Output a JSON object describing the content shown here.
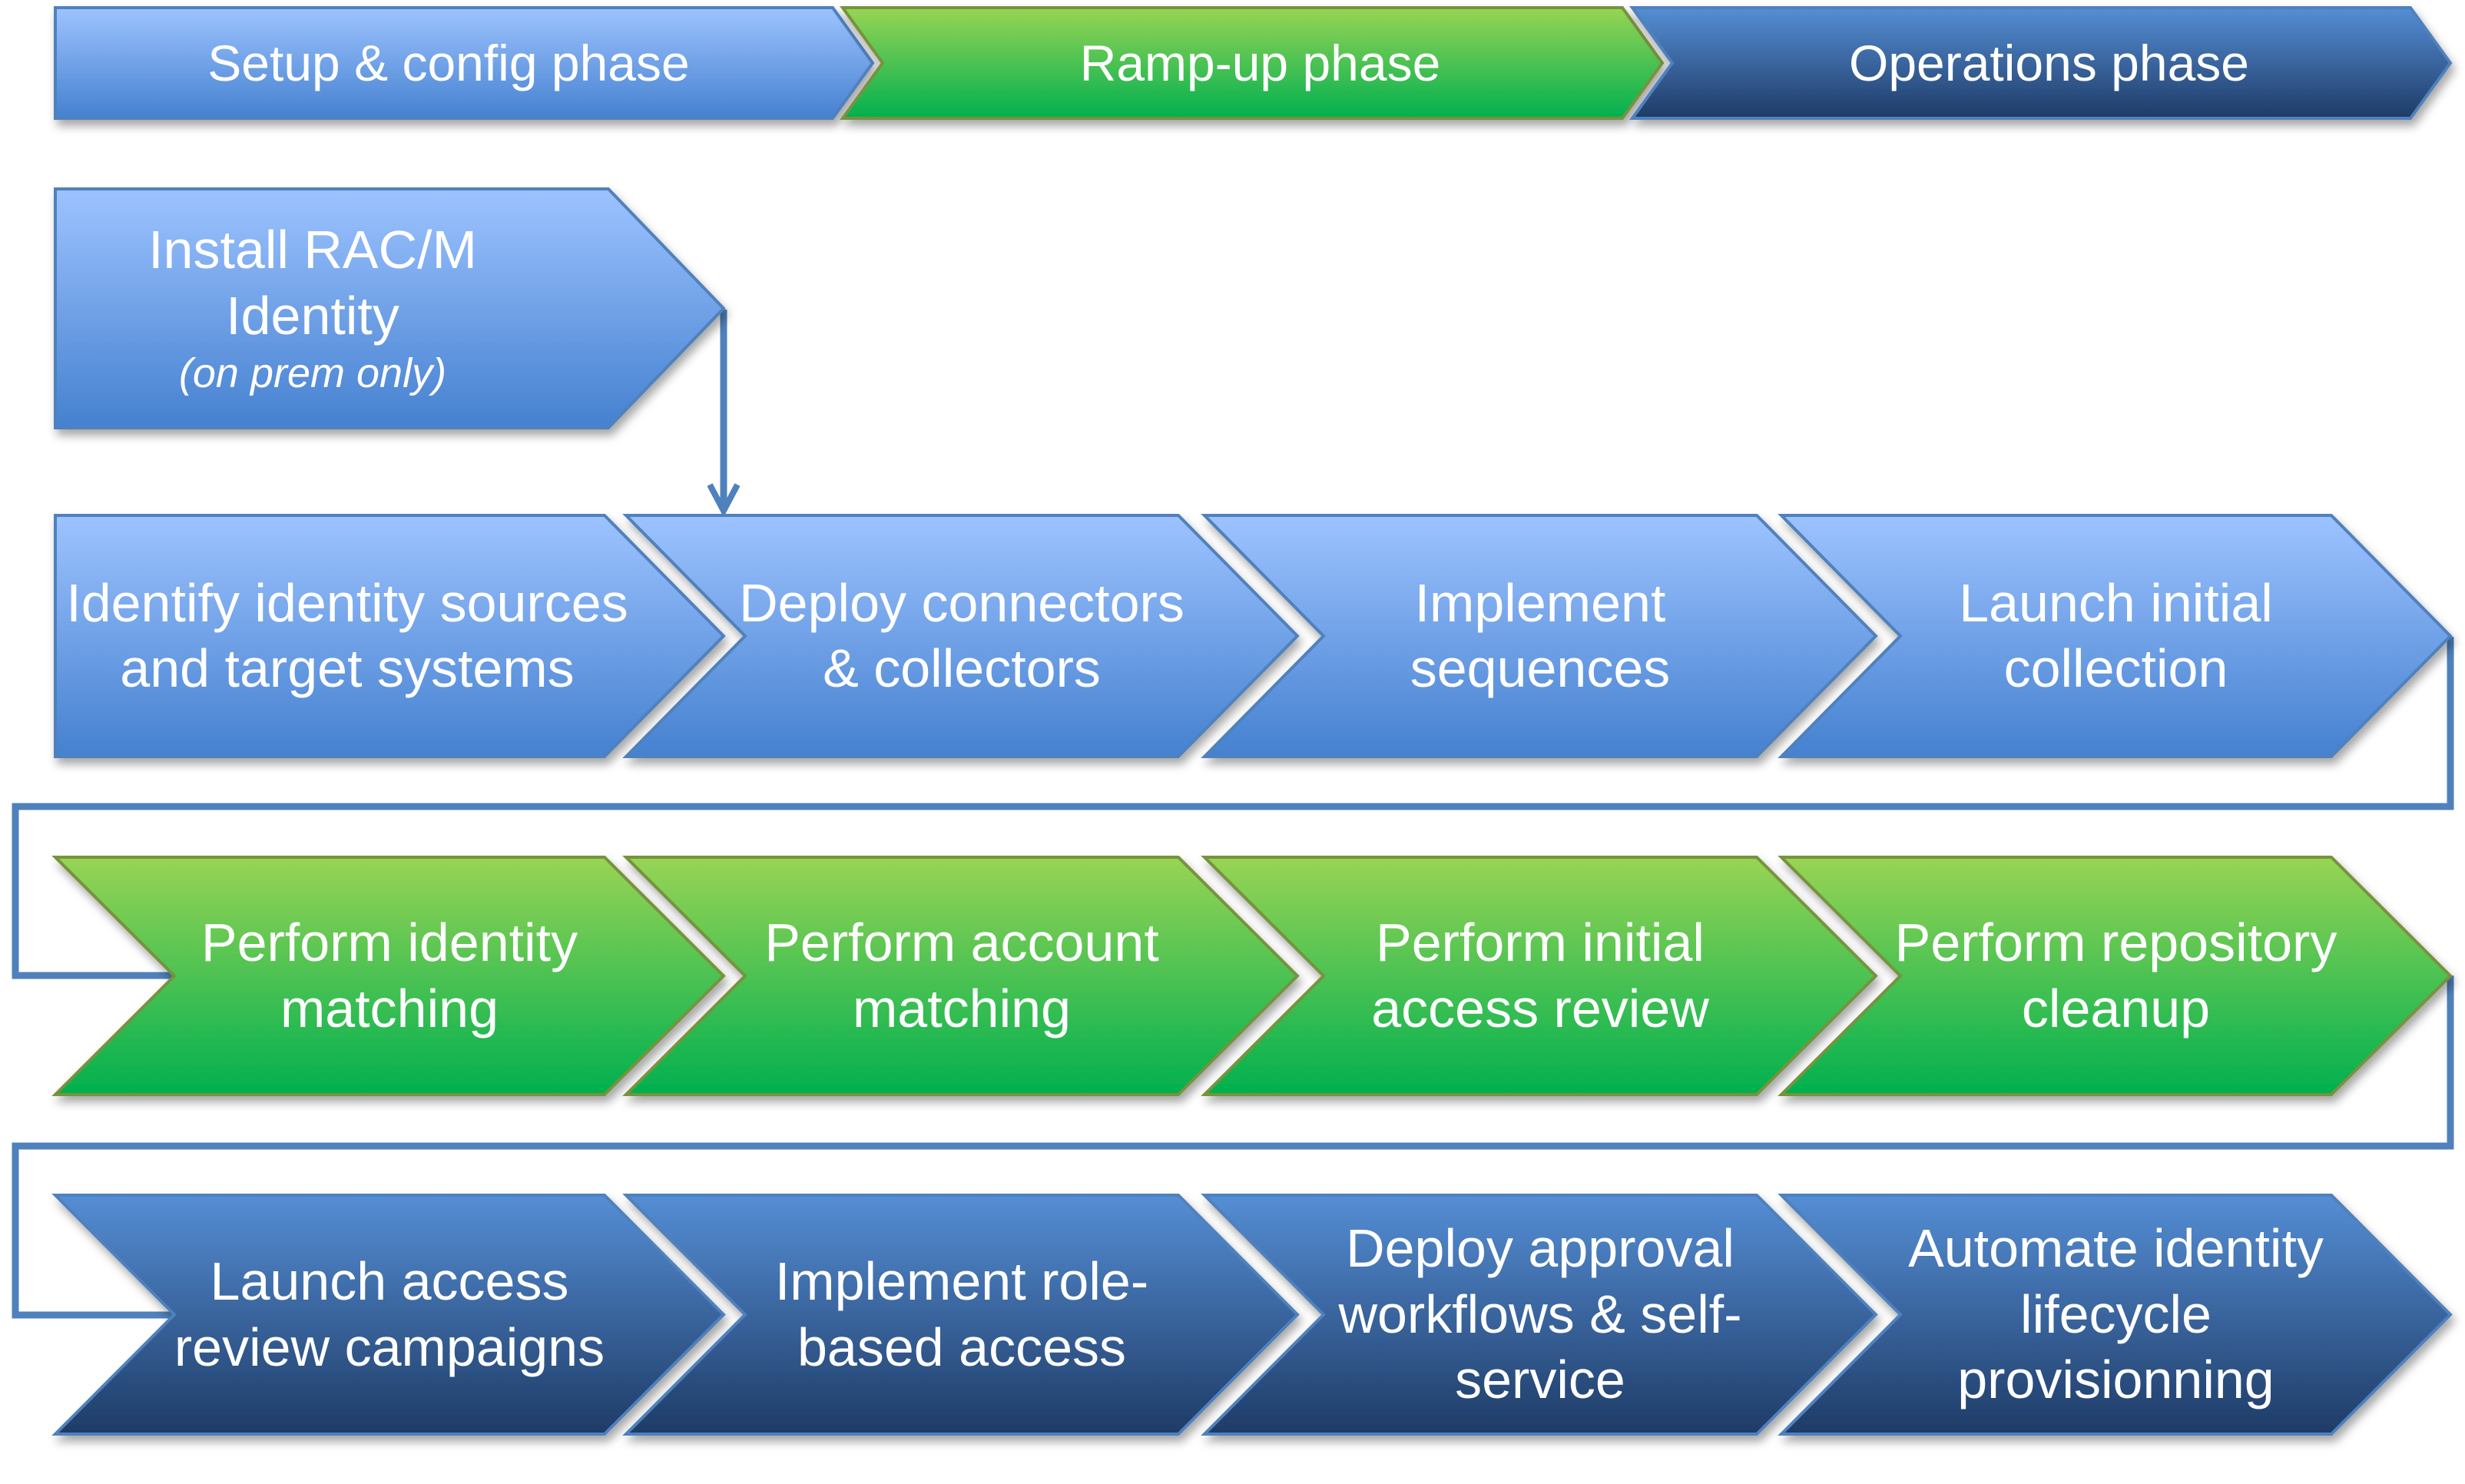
{
  "colors": {
    "light_blue_top": "#9dc3ff",
    "light_blue_bottom": "#4581d0",
    "green_top": "#98d454",
    "green_bottom": "#00b050",
    "dark_blue_top": "#558ed5",
    "dark_blue_bottom": "#1e3b66",
    "blue_stroke": "#4f81bd",
    "green_stroke": "#77933c",
    "connector": "#4f81bd"
  },
  "phases": [
    {
      "label": "Setup & config phase",
      "style": "light"
    },
    {
      "label": "Ramp-up phase",
      "style": "green"
    },
    {
      "label": "Operations phase",
      "style": "dark"
    }
  ],
  "install_step": {
    "label": "Install RAC/M Identity",
    "note": "(on prem only)"
  },
  "rows": [
    {
      "phase": "Setup & config phase",
      "style": "light",
      "steps": [
        "Identify identity sources and target systems",
        "Deploy connectors & collectors",
        "Implement sequences",
        "Launch initial collection"
      ]
    },
    {
      "phase": "Ramp-up phase",
      "style": "green",
      "steps": [
        "Perform identity matching",
        "Perform account matching",
        "Perform  initial access review",
        "Perform repository cleanup"
      ]
    },
    {
      "phase": "Operations phase",
      "style": "dark",
      "steps": [
        "Launch access review campaigns",
        "Implement role-based access",
        "Deploy approval workflows & self-service",
        "Automate identity lifecycle provisionning"
      ]
    }
  ]
}
